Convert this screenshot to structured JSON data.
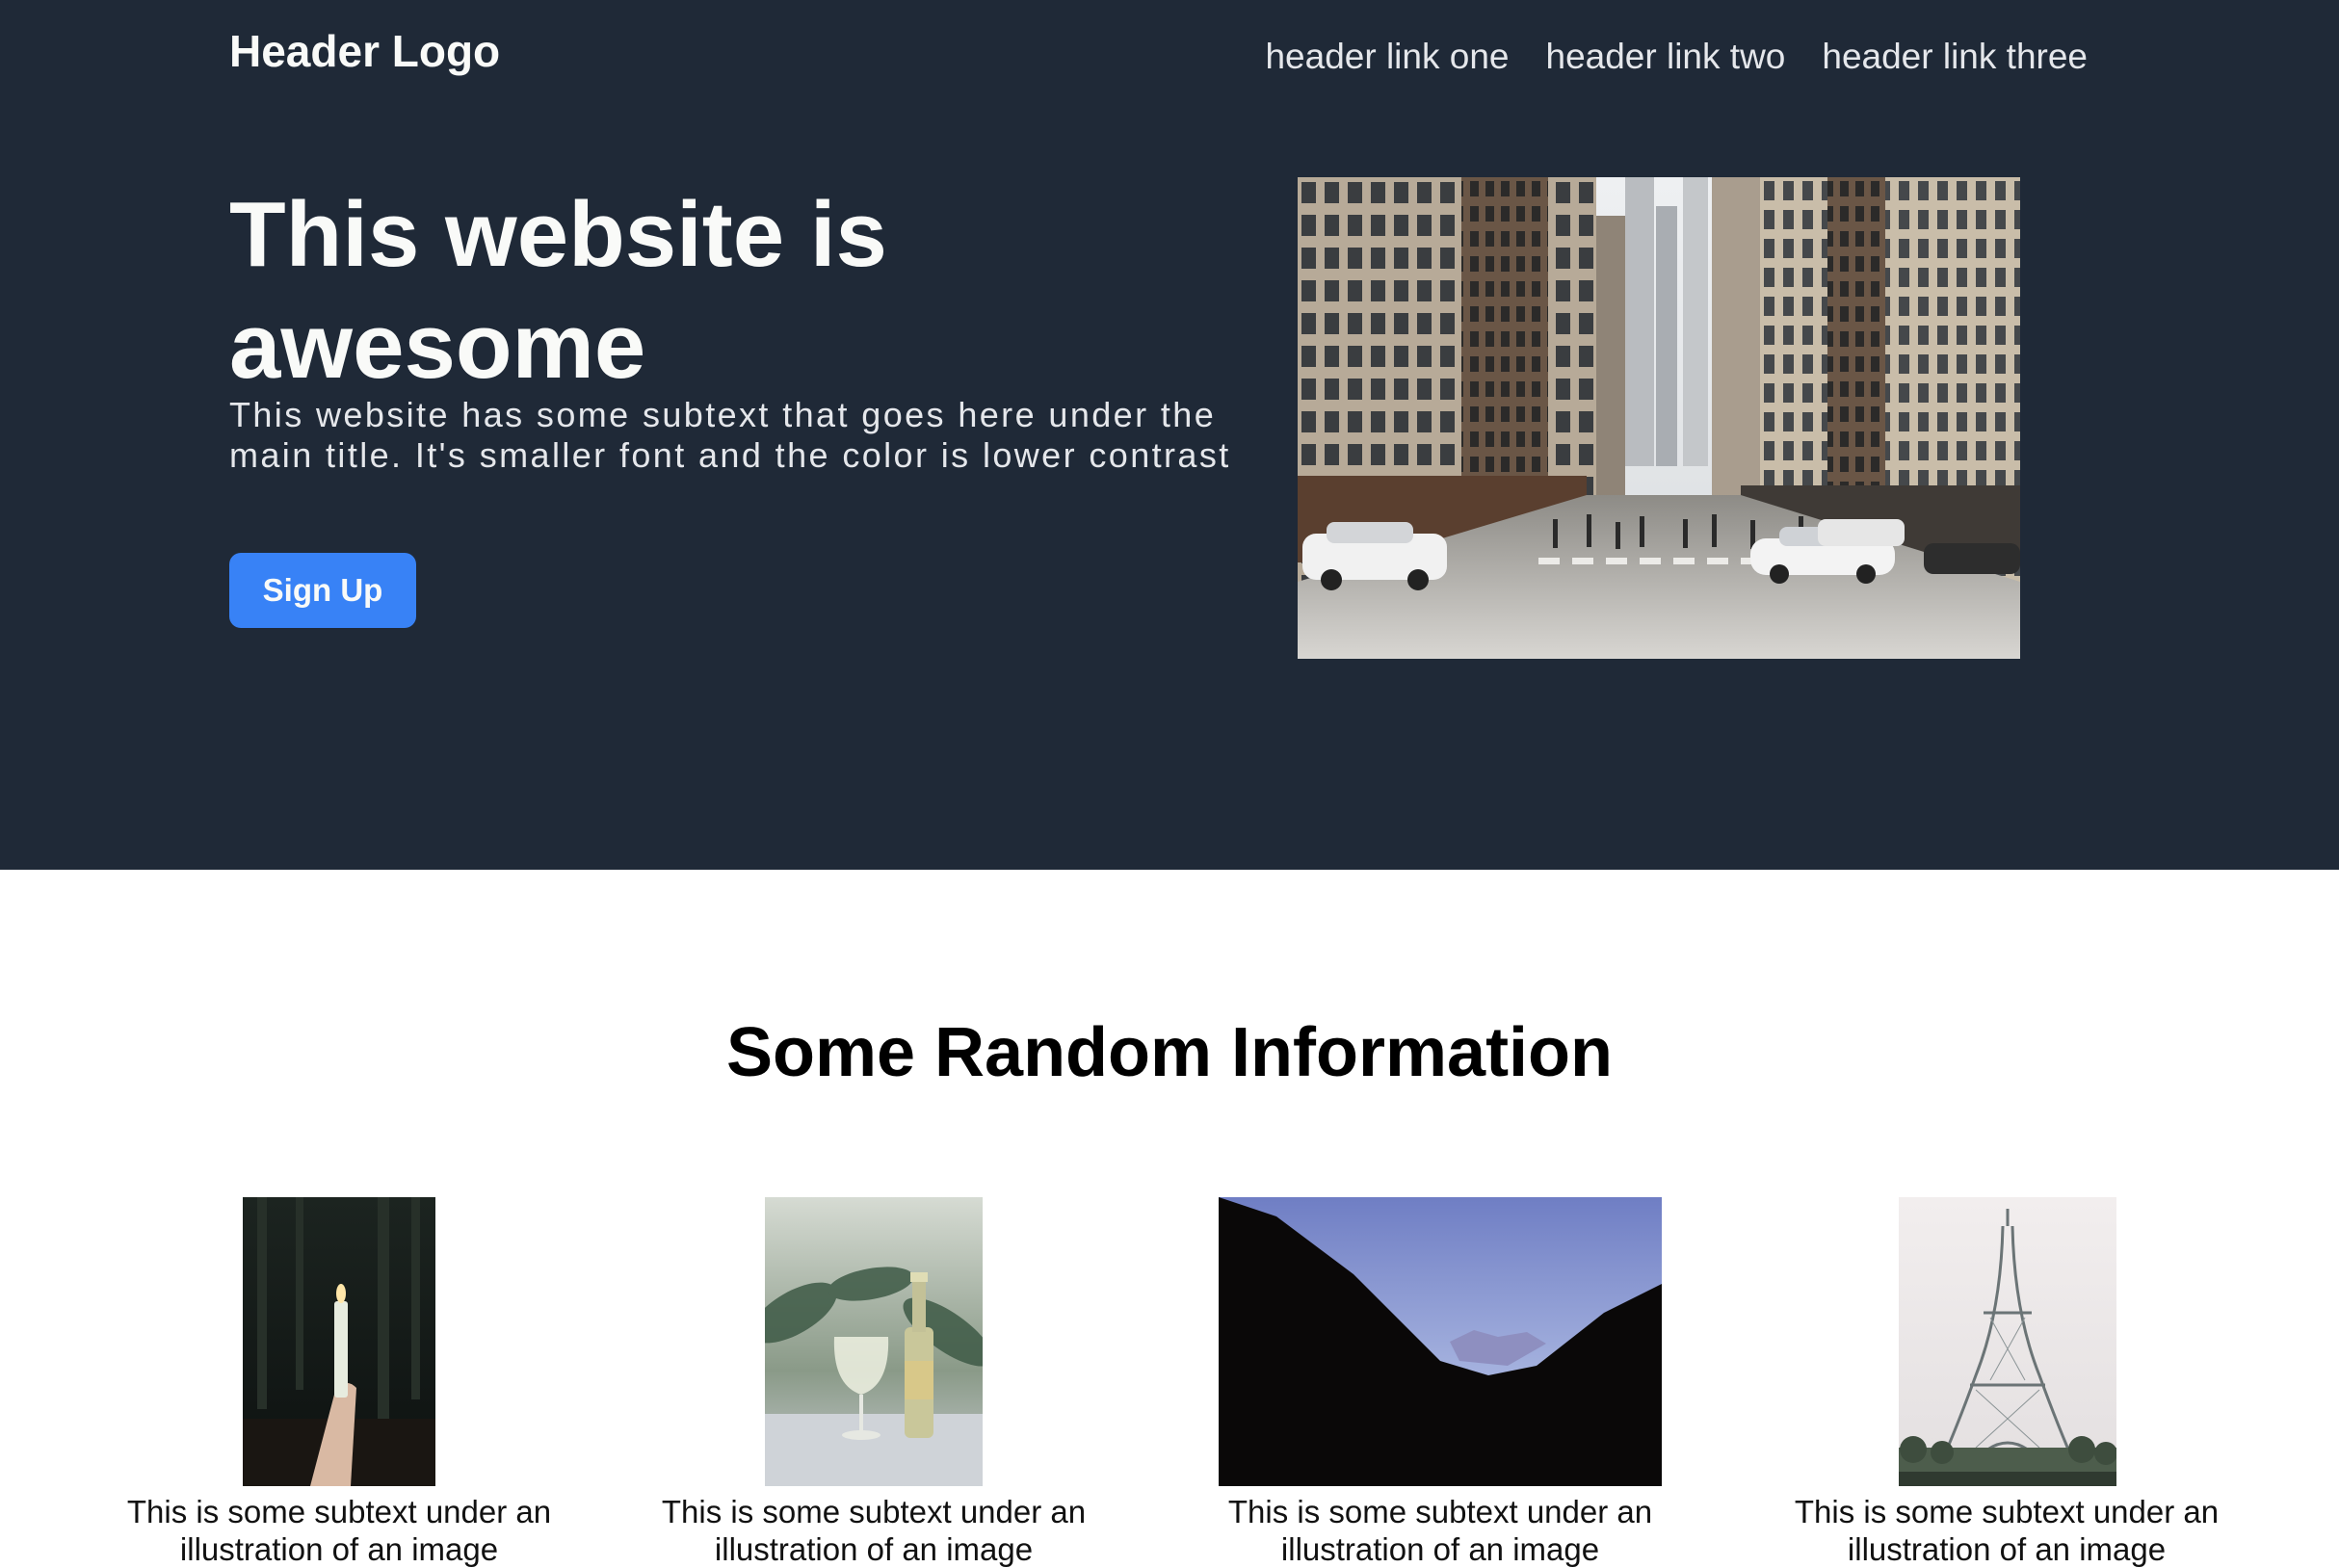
{
  "header": {
    "logo": "Header Logo",
    "links": [
      "header link one",
      "header link two",
      "header link three"
    ]
  },
  "hero": {
    "title": "This website is awesome",
    "subtitle": "This website has some subtext that goes here under the main title. It's smaller font and the color is lower contrast",
    "cta_label": "Sign Up",
    "image_subject": "city-street-photo"
  },
  "info": {
    "title": "Some Random Information",
    "cards": [
      {
        "caption": "This is some subtext under an illustration of an image",
        "image_subject": "hand-holding-candle-in-forest"
      },
      {
        "caption": "This is some subtext under an illustration of an image",
        "image_subject": "wine-glass-and-bottle"
      },
      {
        "caption": "This is some subtext under an illustration of an image",
        "image_subject": "mountain-valley-at-dusk"
      },
      {
        "caption": "This is some subtext under an illustration of an image",
        "image_subject": "eiffel-tower"
      }
    ]
  },
  "colors": {
    "hero_bg": "#1f2937",
    "hero_text": "#f9faf8",
    "hero_subtext": "#e5e7eb",
    "button_bg": "#3882f6"
  }
}
